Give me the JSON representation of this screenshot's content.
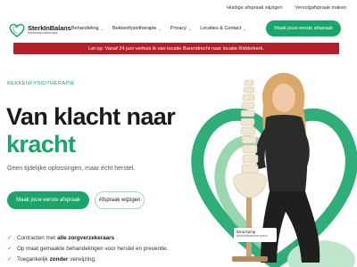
{
  "topbar": {
    "change_appointment": "Huidige afspraak wijzigen",
    "follow_up": "Vervolgafspraak maken"
  },
  "brand": {
    "name": "SterkInBalans",
    "tagline": "bekkenfysiotherapie",
    "logo_icon": "heart-logo-icon"
  },
  "menu": {
    "items": [
      {
        "label": "Behandeling",
        "has_dropdown": true
      },
      {
        "label": "Bekkenfysiotherapie",
        "has_dropdown": true
      },
      {
        "label": "Privacy",
        "has_dropdown": true
      },
      {
        "label": "Locaties & Contact",
        "has_dropdown": true
      }
    ],
    "chevron_icon": "chevron-down-icon",
    "cta": "Maak jouw eerste afspraak"
  },
  "banner": {
    "text": "Let op: Vanaf 24 juni verhuis ik van locatie Barendrecht naar locatie Ridderkerk."
  },
  "hero": {
    "eyebrow": "BEKKENFYSIOTHERAPIE",
    "headline_line1": "Van klacht naar",
    "headline_line2": "kracht",
    "lede": "Geen tijdelijke oplossingen, maar écht herstel.",
    "primary_button": "Maak jouw eerste afspraak",
    "secondary_button": "Afspraak wijzigen"
  },
  "checks": [
    {
      "before": "Contracten met",
      "bold": "alle zorgverzekeraars",
      "after": "."
    },
    {
      "before": "Op maat gemaakte behandelingen voor herstel en preventie.",
      "bold": "",
      "after": ""
    },
    {
      "before": "Toegankelijk",
      "bold": "zonder",
      "after": "verwijzing."
    }
  ],
  "person": {
    "name": "Ilona Kamp",
    "role": "Bekkenfysiotherapeut"
  },
  "colors": {
    "brand_green": "#1aa56a",
    "banner_red": "#b51f2a",
    "light_green": "#8fd3a8"
  }
}
